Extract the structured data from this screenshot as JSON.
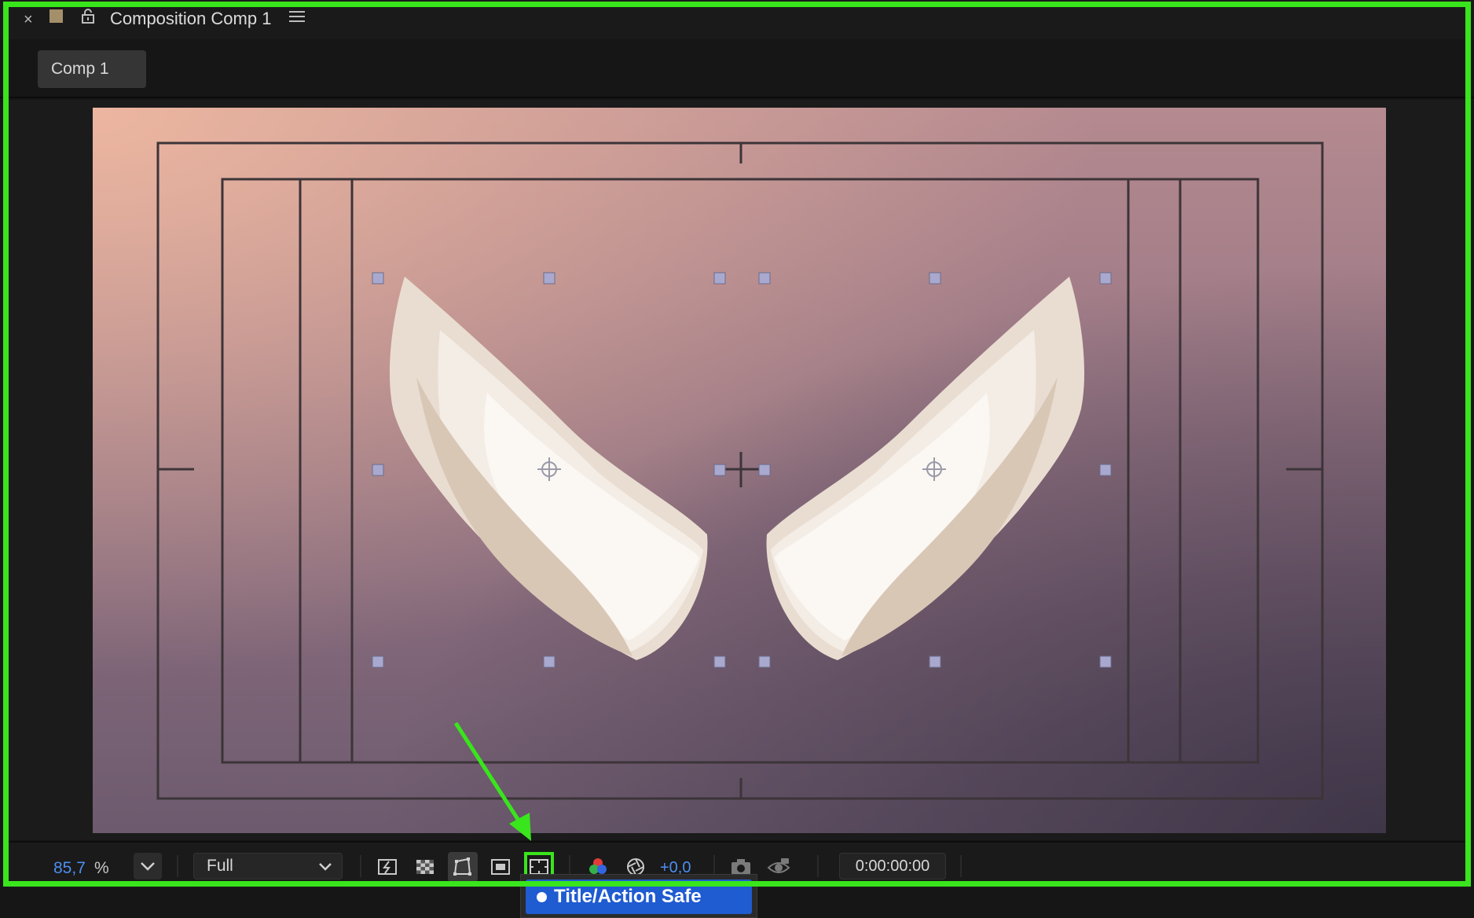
{
  "panel": {
    "close_icon": "×",
    "title": "Composition Comp 1"
  },
  "tabs": [
    {
      "label": "Comp 1"
    }
  ],
  "toolbar": {
    "zoom_value": "85,7",
    "zoom_unit": "%",
    "resolution": "Full",
    "exposure": "+0,0",
    "timecode": "0:00:00:00"
  },
  "popup": {
    "selected_item": "Title/Action Safe"
  },
  "icons": {
    "panel": [
      "close-icon",
      "color-swatch-icon",
      "lock-icon",
      "panel-menu-icon"
    ],
    "toolbar": [
      "chevron-down-icon",
      "fast-preview-icon",
      "transparency-grid-icon",
      "mask-path-icon",
      "region-of-interest-icon",
      "title-action-safe-icon",
      "channels-icon",
      "color-management-icon",
      "snapshot-icon",
      "show-snapshot-icon"
    ]
  },
  "colors": {
    "highlight": "#39e51c",
    "accent": "#4d8ef0",
    "selection": "#1f5bd1"
  }
}
